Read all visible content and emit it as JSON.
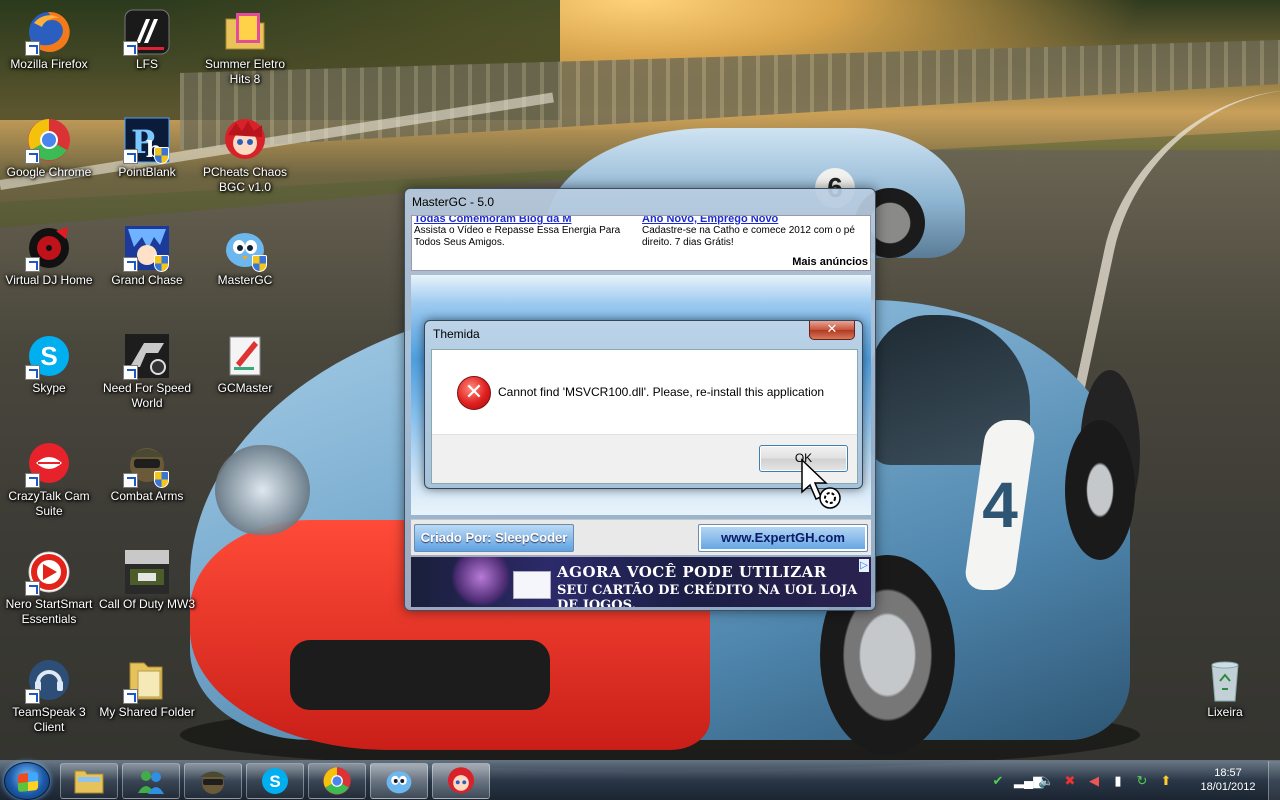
{
  "desktop": {
    "icons": [
      {
        "label": "Mozilla Firefox",
        "icon": "firefox-icon"
      },
      {
        "label": "LFS",
        "icon": "lfs-icon"
      },
      {
        "label": "Summer Eletro Hits 8",
        "icon": "summer-eletro-hits-icon"
      },
      {
        "label": "Google Chrome",
        "icon": "chrome-icon"
      },
      {
        "label": "PointBlank",
        "icon": "pointblank-icon"
      },
      {
        "label": "PCheats Chaos BGC v1.0",
        "icon": "pcheats-icon"
      },
      {
        "label": "Virtual DJ Home",
        "icon": "virtual-dj-icon"
      },
      {
        "label": "Grand Chase",
        "icon": "grand-chase-icon"
      },
      {
        "label": "MasterGC",
        "icon": "mastergc-icon"
      },
      {
        "label": "Skype",
        "icon": "skype-icon"
      },
      {
        "label": "Need For Speed World",
        "icon": "nfs-world-icon"
      },
      {
        "label": "GCMaster",
        "icon": "gcmaster-icon"
      },
      {
        "label": "CrazyTalk Cam Suite",
        "icon": "crazytalk-icon"
      },
      {
        "label": "Combat Arms",
        "icon": "combat-arms-icon"
      },
      {
        "label": "Nero StartSmart Essentials",
        "icon": "nero-icon"
      },
      {
        "label": "Call Of Duty MW3",
        "icon": "cod-mw3-icon"
      },
      {
        "label": "TeamSpeak 3 Client",
        "icon": "teamspeak-icon"
      },
      {
        "label": "My Shared Folder",
        "icon": "folder-icon"
      },
      {
        "label": "Lixeira",
        "icon": "recycle-bin-icon"
      }
    ]
  },
  "mastergc_window": {
    "title": "MasterGC - 5.0",
    "ad_left_link": "Todas Comemoram Blog da M",
    "ad_left_text": "Assista o Vídeo e Repasse Essa Energia Para Todos Seus Amigos.",
    "ad_right_link": "Ano Novo, Emprego Novo",
    "ad_right_text": "Cadastre-se na Catho e comece 2012 com o pé direito. 7 dias Grátis!",
    "ad_more": "Mais anúncios",
    "credit_button": "Criado Por: SleepCoder",
    "site_button": "www.ExpertGH.com",
    "banner_line1": "AGORA VOCÊ PODE UTILIZAR",
    "banner_line2": "SEU CARTÃO DE CRÉDITO NA UOL LOJA DE JOGOS."
  },
  "themida_dialog": {
    "title": "Themida",
    "close_glyph": "✕",
    "message": "Cannot find 'MSVCR100.dll'. Please, re-install this application",
    "ok_label": "OK",
    "error_glyph": "✕"
  },
  "taskbar": {
    "pinned": [
      {
        "icon": "explorer-icon"
      },
      {
        "icon": "messenger-icon"
      },
      {
        "icon": "combat-arms-icon"
      },
      {
        "icon": "skype-icon"
      },
      {
        "icon": "chrome-icon"
      },
      {
        "icon": "mastergc-icon"
      },
      {
        "icon": "pcheats-icon"
      }
    ],
    "clock_time": "18:57",
    "clock_date": "18/01/2012"
  },
  "colors": {
    "dialog_accent": "#3c7fb1",
    "error_red": "#e01f1f",
    "link_blue": "#1c2bd0"
  }
}
